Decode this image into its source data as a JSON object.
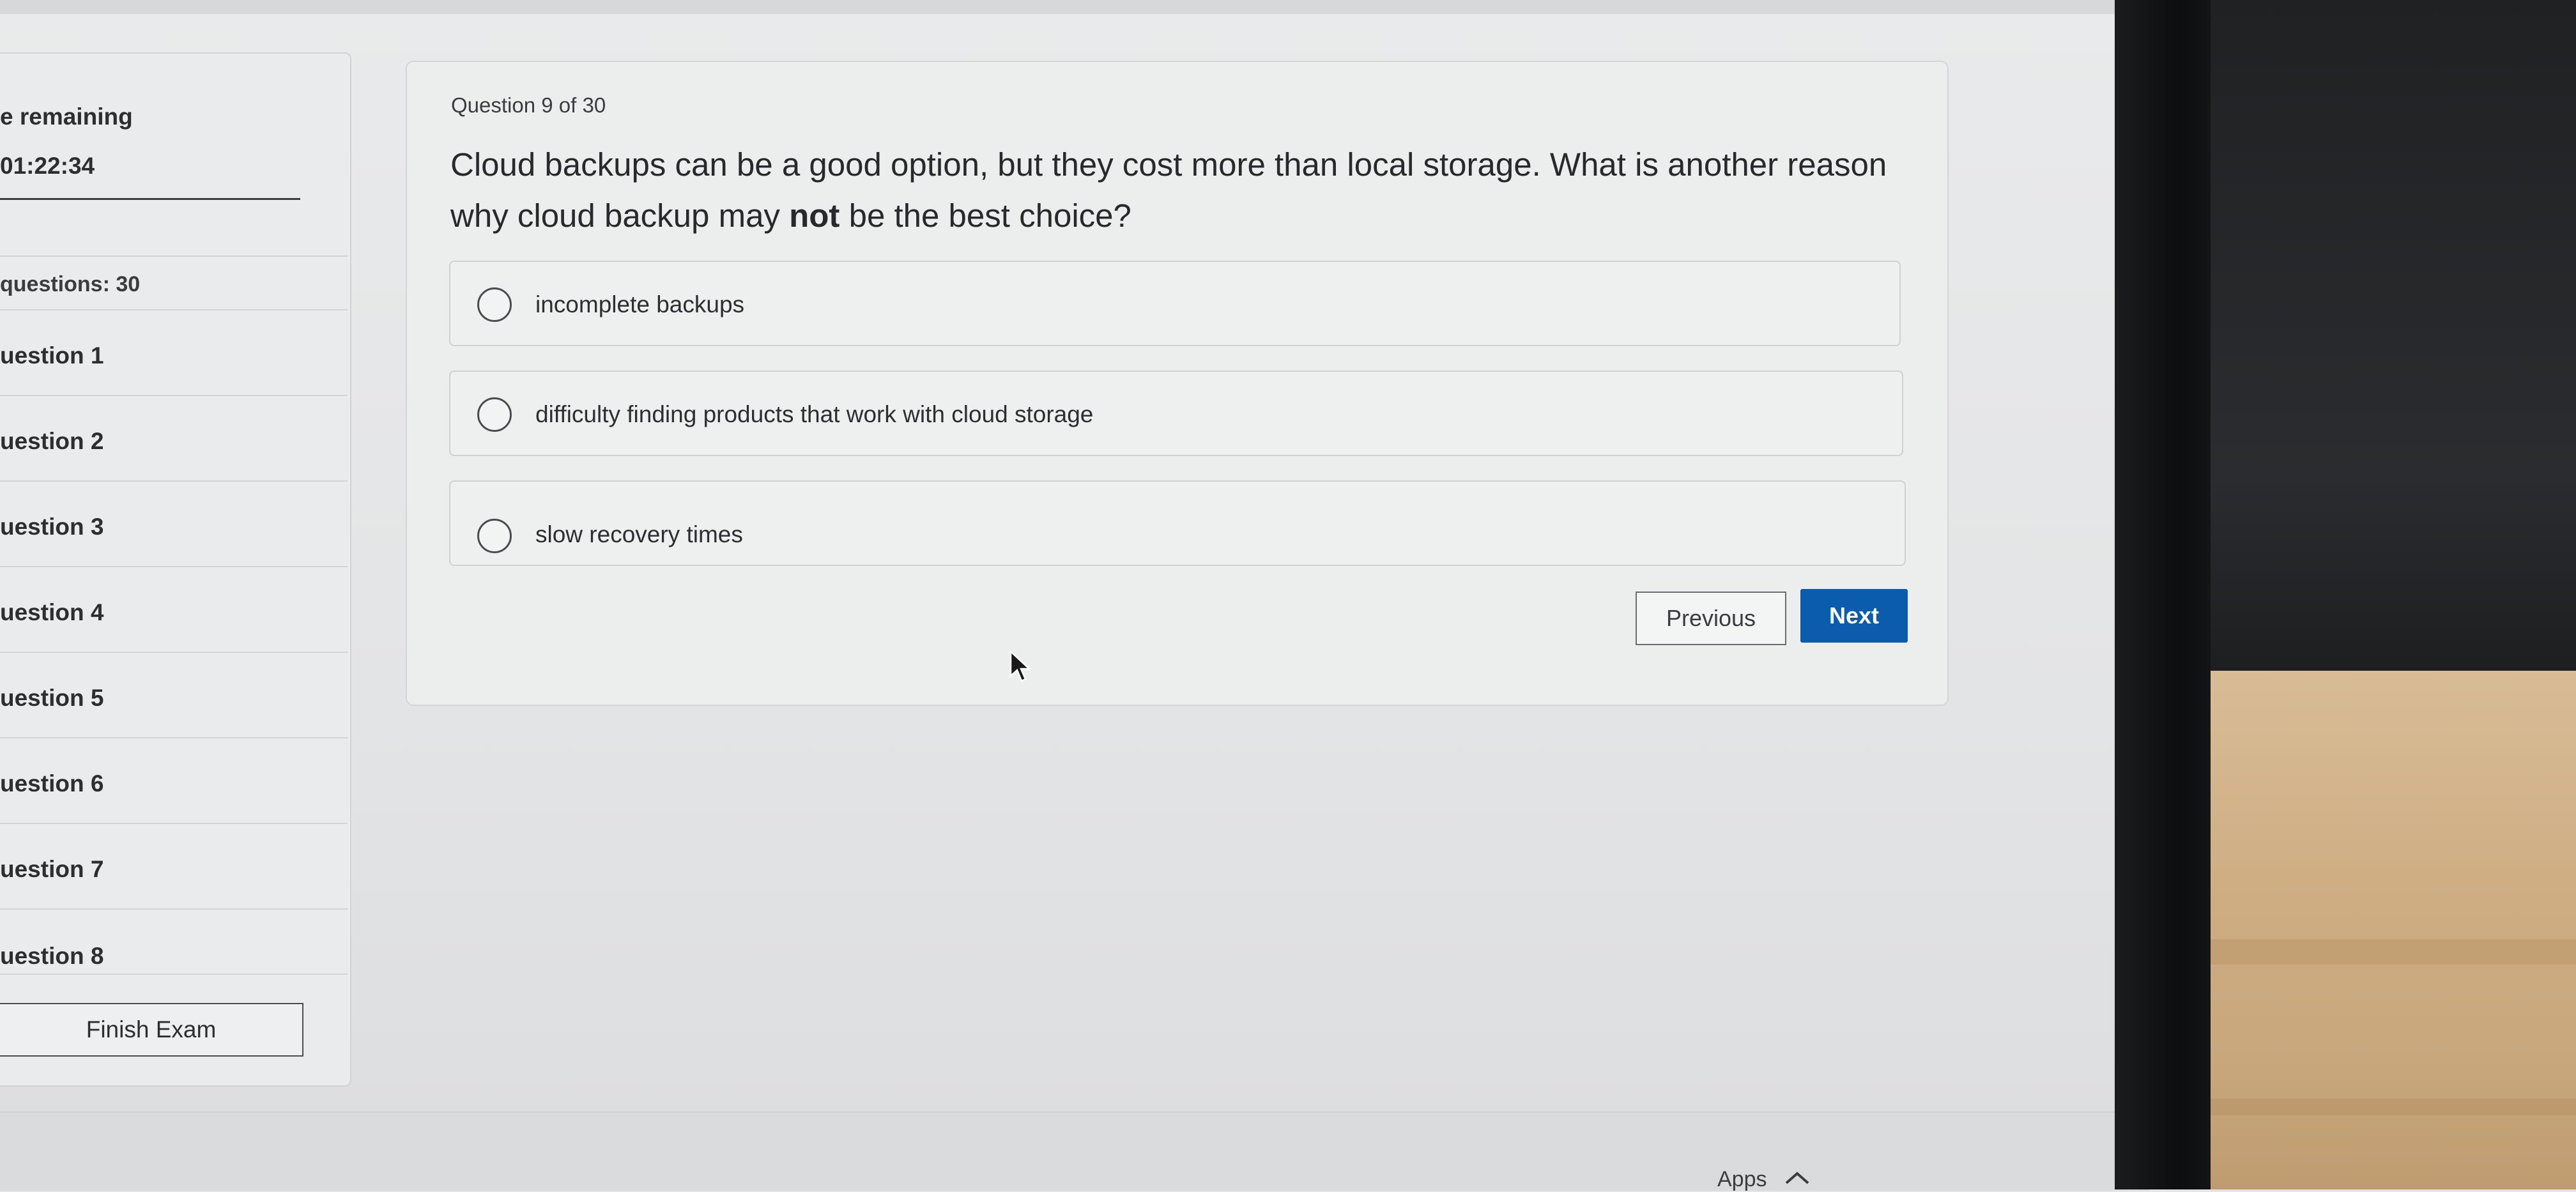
{
  "sidebar": {
    "timer_label": "e remaining",
    "timer_value": "01:22:34",
    "questions_count": "questions: 30",
    "items": [
      {
        "label": "uestion 1"
      },
      {
        "label": "uestion 2"
      },
      {
        "label": "uestion 3"
      },
      {
        "label": "uestion 4"
      },
      {
        "label": "uestion 5"
      },
      {
        "label": "uestion 6"
      },
      {
        "label": "uestion 7"
      },
      {
        "label": "uestion 8"
      }
    ],
    "finish_label": "Finish Exam"
  },
  "question": {
    "progress": "Question 9 of 30",
    "text_before": "Cloud backups can be a good option, but they cost more than local storage. What is another reason why cloud backup may ",
    "text_bold": "not",
    "text_after": " be the best choice?",
    "options": [
      {
        "label": "incomplete backups",
        "selected": false
      },
      {
        "label": "difficulty finding products that work with cloud storage",
        "selected": false
      },
      {
        "label": "slow recovery times",
        "selected": false
      }
    ]
  },
  "nav": {
    "previous_label": "Previous",
    "next_label": "Next"
  },
  "footer": {
    "apps_label": "Apps"
  },
  "colors": {
    "primary_button": "#0b5cad",
    "page_background": "#e9eaeb"
  }
}
